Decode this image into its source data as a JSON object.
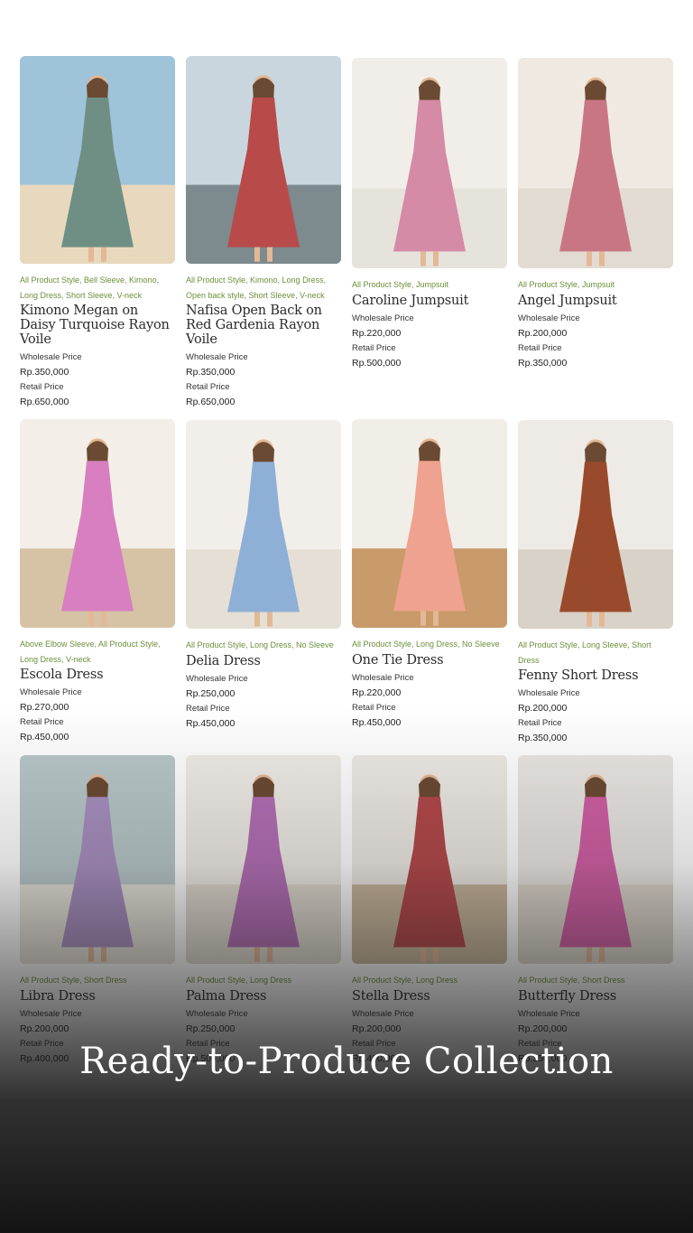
{
  "headline": "Ready-to-Produce Collection",
  "labels": {
    "wholesale": "Wholesale Price",
    "retail": "Retail Price"
  },
  "products": [
    {
      "tags": "All Product Style, Bell Sleeve, Kimono, Long Dress, Short Sleeve, V-neck",
      "name": "Kimono Megan on Daisy Turquoise Rayon Voile",
      "wholesale": "Rp.350,000",
      "retail": "Rp.650,000",
      "palette": {
        "bg": "#9fc3d9",
        "ground": "#e8d8bd",
        "dress": "#6f8f84"
      }
    },
    {
      "tags": "All Product Style, Kimono, Long Dress, Open back style, Short Sleeve, V-neck",
      "name": "Nafisa Open Back on Red Gardenia Rayon Voile",
      "wholesale": "Rp.350,000",
      "retail": "Rp.650,000",
      "palette": {
        "bg": "#c9d6de",
        "ground": "#7d8a8e",
        "dress": "#b94a4a"
      }
    },
    {
      "tags": "All Product Style, Jumpsuit",
      "name": "Caroline Jumpsuit",
      "wholesale": "Rp.220,000",
      "retail": "Rp.500,000",
      "palette": {
        "bg": "#f1eeea",
        "ground": "#e6e2dc",
        "dress": "#d58aa6"
      }
    },
    {
      "tags": "All Product Style, Jumpsuit",
      "name": "Angel Jumpsuit",
      "wholesale": "Rp.200,000",
      "retail": "Rp.350,000",
      "palette": {
        "bg": "#efe9e1",
        "ground": "#e2dbd1",
        "dress": "#c97684"
      }
    },
    {
      "tags": "Above Elbow Sleeve, All Product Style, Long Dress, V-neck",
      "name": "Escola Dress",
      "wholesale": "Rp.270,000",
      "retail": "Rp.450,000",
      "palette": {
        "bg": "#f3efe8",
        "ground": "#d6c3a6",
        "dress": "#d77fc0"
      }
    },
    {
      "tags": "All Product Style, Long Dress, No Sleeve",
      "name": "Delia Dress",
      "wholesale": "Rp.250,000",
      "retail": "Rp.450,000",
      "palette": {
        "bg": "#f2efeb",
        "ground": "#e6dfd5",
        "dress": "#8fb0d6"
      }
    },
    {
      "tags": "All Product Style, Long Dress, No Sleeve",
      "name": "One Tie Dress",
      "wholesale": "Rp.220,000",
      "retail": "Rp.450,000",
      "palette": {
        "bg": "#f1ede7",
        "ground": "#c99a6a",
        "dress": "#efa28f"
      }
    },
    {
      "tags": "All Product Style, Long Sleeve, Short Dress",
      "name": "Fenny Short Dress",
      "wholesale": "Rp.200,000",
      "retail": "Rp.350,000",
      "palette": {
        "bg": "#eeebe6",
        "ground": "#d9d2c8",
        "dress": "#9a4a2c"
      }
    },
    {
      "tags": "All Product Style, Short Dress",
      "name": "Libra Dress",
      "wholesale": "Rp.200,000",
      "retail": "Rp.400,000",
      "palette": {
        "bg": "#b8c7c9",
        "ground": "#e7e2da",
        "dress": "#a88fc0"
      }
    },
    {
      "tags": "All Product Style, Long Dress",
      "name": "Palma Dress",
      "wholesale": "Rp.250,000",
      "retail": "Rp.500,000",
      "palette": {
        "bg": "#efebe6",
        "ground": "#e1dad0",
        "dress": "#b46fb6"
      }
    },
    {
      "tags": "All Product Style, Long Dress",
      "name": "Stella Dress",
      "wholesale": "Rp.200,000",
      "retail": "Rp.400,000",
      "palette": {
        "bg": "#ede9e4",
        "ground": "#c9b79c",
        "dress": "#b3484a"
      }
    },
    {
      "tags": "All Product Style, Short Dress",
      "name": "Butterfly Dress",
      "wholesale": "Rp.200,000",
      "retail": "Rp.350,000",
      "palette": {
        "bg": "#e9e6e2",
        "ground": "#ddd6cc",
        "dress": "#d15fa4"
      }
    }
  ]
}
